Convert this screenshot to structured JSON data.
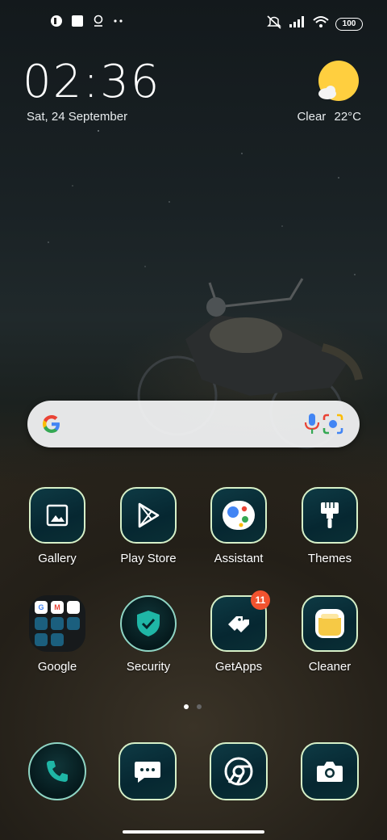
{
  "status_bar": {
    "battery": "100",
    "icons": [
      "notification-icon",
      "square-icon",
      "location-pin-icon",
      "more-dots-icon",
      "mute-icon",
      "signal-icon",
      "wifi-icon",
      "battery-icon"
    ]
  },
  "clock": {
    "time": "02:36",
    "date": "Sat, 24 September"
  },
  "weather": {
    "condition": "Clear",
    "temperature": "22°C",
    "icon": "sun-cloud-icon"
  },
  "search": {
    "icons": [
      "google-g-icon",
      "mic-icon",
      "lens-icon"
    ]
  },
  "apps": [
    {
      "label": "Gallery",
      "icon": "gallery-icon"
    },
    {
      "label": "Play Store",
      "icon": "play-store-icon"
    },
    {
      "label": "Assistant",
      "icon": "assistant-icon"
    },
    {
      "label": "Themes",
      "icon": "themes-brush-icon"
    },
    {
      "label": "Google",
      "icon": "folder-icon"
    },
    {
      "label": "Security",
      "icon": "security-shield-icon"
    },
    {
      "label": "GetApps",
      "icon": "getapps-icon",
      "badge": "11"
    },
    {
      "label": "Cleaner",
      "icon": "cleaner-icon"
    }
  ],
  "folder_items": [
    "G",
    "M",
    "",
    "",
    "",
    "",
    "",
    ""
  ],
  "pages": {
    "count": 2,
    "current": 1
  },
  "dock": [
    {
      "icon": "phone-icon"
    },
    {
      "icon": "messages-icon"
    },
    {
      "icon": "chrome-icon"
    },
    {
      "icon": "camera-icon"
    }
  ],
  "colors": {
    "tile_border": "#d6f0c8",
    "tile_bg": "#0a2f35",
    "badge": "#f1532f"
  }
}
